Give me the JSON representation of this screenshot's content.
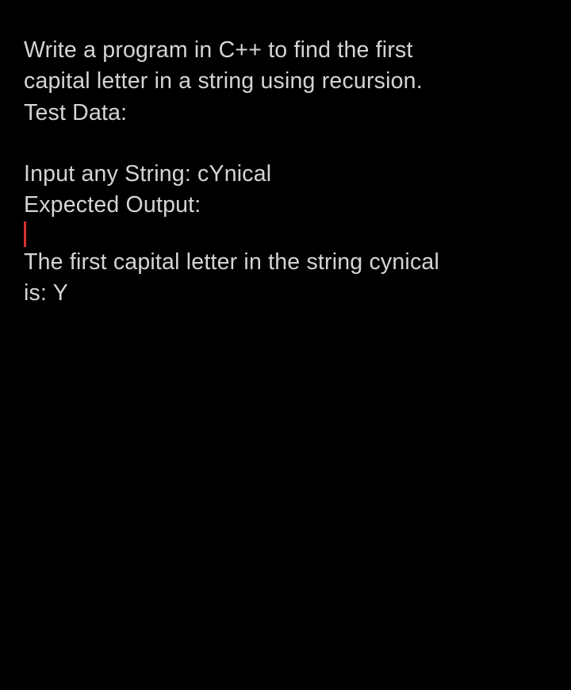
{
  "problem": {
    "line1": "Write a program in C++  to find the first",
    "line2": "capital letter in a string using recursion.",
    "line3": "Test Data:"
  },
  "input_section": {
    "line1": "Input any String: cYnical",
    "line2": "Expected Output:"
  },
  "output_section": {
    "line1": "The first capital letter in the string cynical",
    "line2": "is: Y"
  }
}
